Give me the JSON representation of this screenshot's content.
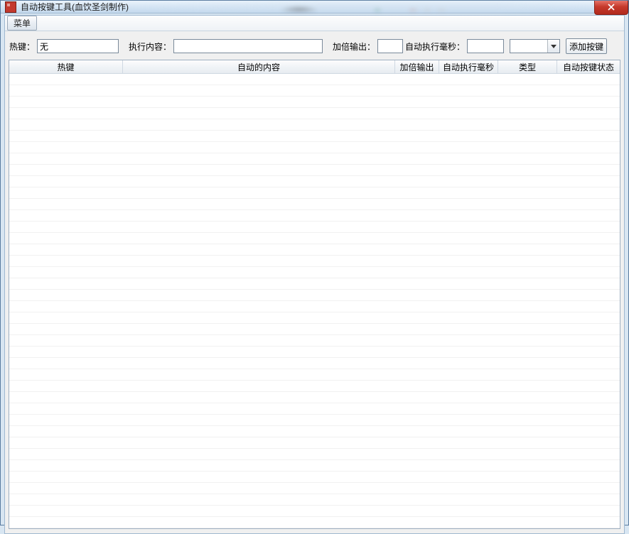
{
  "window": {
    "title": "自动按键工具(血饮圣剑制作)"
  },
  "menubar": {
    "menu_label": "菜单"
  },
  "form": {
    "hotkey_label": "热键：",
    "hotkey_value": "无",
    "content_label": "执行内容：",
    "content_value": "",
    "double_label": "加倍输出：",
    "double_value": "",
    "ms_label": "自动执行毫秒：",
    "ms_value": "",
    "type_value": "",
    "add_button_label": "添加按键"
  },
  "grid": {
    "columns": {
      "hotkey": "热键",
      "content": "自动的内容",
      "double": "加倍输出",
      "ms": "自动执行毫秒",
      "type": "类型",
      "status": "自动按键状态"
    },
    "rows": []
  }
}
